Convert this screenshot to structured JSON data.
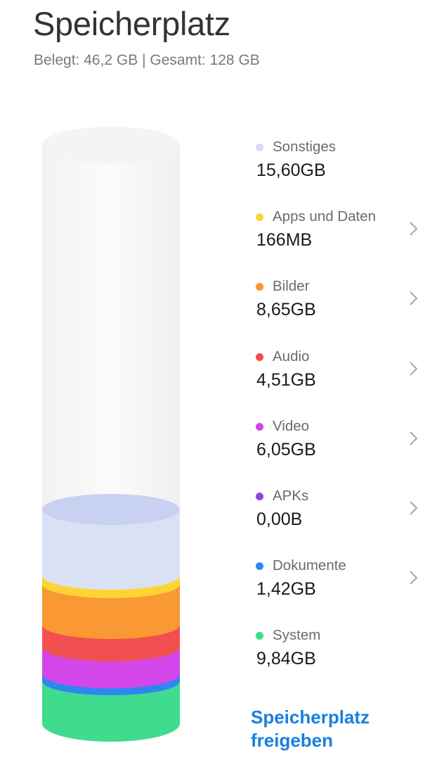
{
  "header": {
    "title": "Speicherplatz",
    "subtitle": "Belegt: 46,2 GB | Gesamt: 128 GB"
  },
  "legend": [
    {
      "label": "Sonstiges",
      "value": "15,60GB",
      "color": "#d5dcf4",
      "chevron": false
    },
    {
      "label": "Apps und Daten",
      "value": "166MB",
      "color": "#fcd535",
      "chevron": true
    },
    {
      "label": "Bilder",
      "value": "8,65GB",
      "color": "#fa9530",
      "chevron": true
    },
    {
      "label": "Audio",
      "value": "4,51GB",
      "color": "#f24b4b",
      "chevron": true
    },
    {
      "label": "Video",
      "value": "6,05GB",
      "color": "#d146e8",
      "chevron": true
    },
    {
      "label": "APKs",
      "value": "0,00B",
      "color": "#8a47e0",
      "chevron": true
    },
    {
      "label": "Dokumente",
      "value": "1,42GB",
      "color": "#2f86ef",
      "chevron": true
    },
    {
      "label": "System",
      "value": "9,84GB",
      "color": "#3ddc8c",
      "chevron": false
    }
  ],
  "action": {
    "free_label_line1": "Speicherplatz",
    "free_label_line2": "freigeben"
  },
  "chevron_icon": "chevron-right-icon"
}
